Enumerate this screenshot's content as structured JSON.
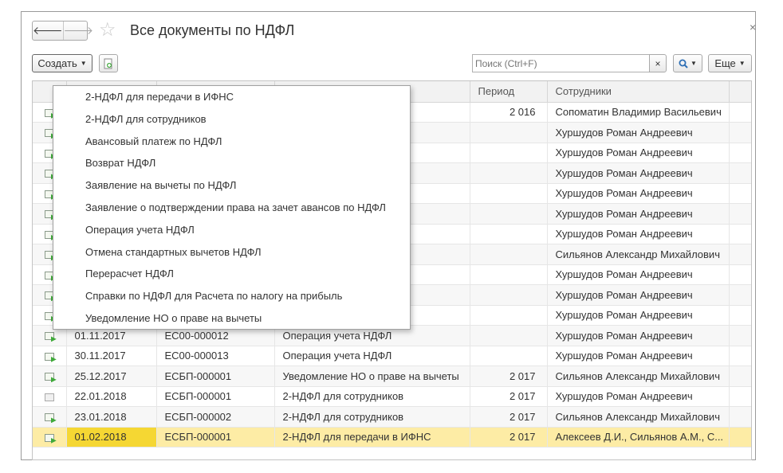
{
  "header": {
    "title": "Все документы по НДФЛ",
    "back_icon": "arrow-left-icon",
    "forward_icon": "arrow-right-icon",
    "favorite_icon": "star-icon",
    "close_label": "×"
  },
  "toolbar": {
    "create_label": "Создать",
    "search_placeholder": "Поиск (Ctrl+F)",
    "search_clear": "×",
    "more_label": "Еще"
  },
  "table": {
    "columns": [
      "",
      "",
      "",
      "Период",
      "Сотрудники"
    ],
    "rows": [
      {
        "date": "",
        "number": "",
        "type": "",
        "period": "2 016",
        "employees": "Сопоматин Владимир Васильевич",
        "icon": "posted"
      },
      {
        "date": "",
        "number": "",
        "type": "",
        "period": "",
        "employees": "Хуршудов Роман Андреевич",
        "icon": "posted"
      },
      {
        "date": "",
        "number": "",
        "type": "",
        "period": "",
        "employees": "Хуршудов Роман Андреевич",
        "icon": "posted"
      },
      {
        "date": "",
        "number": "",
        "type": "",
        "period": "",
        "employees": "Хуршудов Роман Андреевич",
        "icon": "posted"
      },
      {
        "date": "",
        "number": "",
        "type": "",
        "period": "",
        "employees": "Хуршудов Роман Андреевич",
        "icon": "posted"
      },
      {
        "date": "",
        "number": "",
        "type": "",
        "period": "",
        "employees": "Хуршудов Роман Андреевич",
        "icon": "posted"
      },
      {
        "date": "",
        "number": "",
        "type": "",
        "period": "",
        "employees": "Хуршудов Роман Андреевич",
        "icon": "posted"
      },
      {
        "date": "",
        "number": "",
        "type": "",
        "period": "",
        "employees": "Сильянов Александр Михайлович",
        "icon": "posted"
      },
      {
        "date": "",
        "number": "",
        "type": "",
        "period": "",
        "employees": "Хуршудов Роман Андреевич",
        "icon": "posted"
      },
      {
        "date": "",
        "number": "",
        "type": "",
        "period": "",
        "employees": "Хуршудов Роман Андреевич",
        "icon": "posted"
      },
      {
        "date": "",
        "number": "",
        "type": "",
        "period": "",
        "employees": "Хуршудов Роман Андреевич",
        "icon": "posted"
      },
      {
        "date": "01.11.2017",
        "number": "ЕС00-000012",
        "type": "Операция учета НДФЛ",
        "period": "",
        "employees": "Хуршудов Роман Андреевич",
        "icon": "posted"
      },
      {
        "date": "30.11.2017",
        "number": "ЕС00-000013",
        "type": "Операция учета НДФЛ",
        "period": "",
        "employees": "Хуршудов Роман Андреевич",
        "icon": "posted"
      },
      {
        "date": "25.12.2017",
        "number": "ЕСБП-000001",
        "type": "Уведомление НО о праве на вычеты",
        "period": "2 017",
        "employees": "Сильянов Александр Михайлович",
        "icon": "posted"
      },
      {
        "date": "22.01.2018",
        "number": "ЕСБП-000001",
        "type": "2-НДФЛ для сотрудников",
        "period": "2 017",
        "employees": "Хуршудов Роман Андреевич",
        "icon": "plain"
      },
      {
        "date": "23.01.2018",
        "number": "ЕСБП-000002",
        "type": "2-НДФЛ для сотрудников",
        "period": "2 017",
        "employees": "Сильянов Александр Михайлович",
        "icon": "posted"
      },
      {
        "date": "01.02.2018",
        "number": "ЕСБП-000001",
        "type": "2-НДФЛ для передачи в ИФНС",
        "period": "2 017",
        "employees": "Алексеев Д.И., Сильянов А.М., С...",
        "icon": "posted"
      }
    ]
  },
  "create_menu": {
    "items": [
      "2-НДФЛ для передачи в ИФНС",
      "2-НДФЛ для сотрудников",
      "Авансовый платеж по НДФЛ",
      "Возврат НДФЛ",
      "Заявление на вычеты по НДФЛ",
      "Заявление о подтверждении права на зачет авансов по НДФЛ",
      "Операция учета НДФЛ",
      "Отмена стандартных вычетов НДФЛ",
      "Перерасчет НДФЛ",
      "Справки по НДФЛ для Расчета по налогу на прибыль",
      "Уведомление НО о праве на вычеты"
    ]
  },
  "colors": {
    "selected_row": "#fdeca5",
    "current_cell": "#f5d733",
    "posted_icon": "#3faa3a"
  }
}
